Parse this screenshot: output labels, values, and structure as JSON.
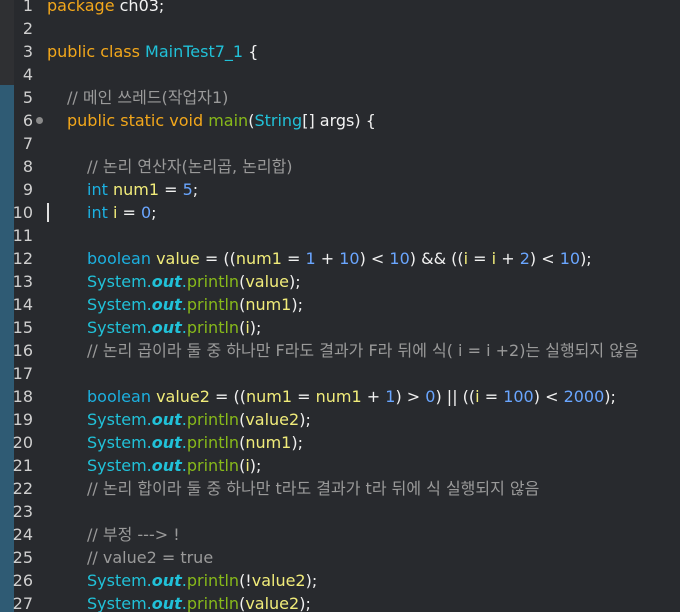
{
  "colors": {
    "background": "#282a2e",
    "keyword": "#f2a71b",
    "type": "#1cb0e0",
    "class_name": "#21c1d8",
    "method": "#87b91a",
    "variable": "#f1ec7a",
    "number": "#6aa6ff",
    "comment": "#9a9a9a",
    "change_bar": "#2f5b74"
  },
  "editor": {
    "cursor_line": 10,
    "lines": [
      {
        "n": "1",
        "indent": 0,
        "tokens": [
          {
            "t": "package",
            "c": "kw"
          },
          {
            "t": " ch03;",
            "c": "id"
          }
        ]
      },
      {
        "n": "2",
        "indent": 0,
        "tokens": []
      },
      {
        "n": "3",
        "indent": 0,
        "tokens": [
          {
            "t": "public",
            "c": "kw"
          },
          {
            "t": " ",
            "c": "id"
          },
          {
            "t": "class",
            "c": "kw"
          },
          {
            "t": " ",
            "c": "id"
          },
          {
            "t": "MainTest7_1",
            "c": "cl"
          },
          {
            "t": " {",
            "c": "id"
          }
        ]
      },
      {
        "n": "4",
        "indent": 0,
        "tokens": []
      },
      {
        "n": "5",
        "indent": 1,
        "tokens": [
          {
            "t": "// 메인 쓰레드(작업자1)",
            "c": "cm"
          }
        ]
      },
      {
        "n": "6",
        "indent": 1,
        "fold": true,
        "tokens": [
          {
            "t": "public",
            "c": "kw"
          },
          {
            "t": " ",
            "c": "id"
          },
          {
            "t": "static",
            "c": "kw"
          },
          {
            "t": " ",
            "c": "id"
          },
          {
            "t": "void",
            "c": "kw"
          },
          {
            "t": " ",
            "c": "id"
          },
          {
            "t": "main",
            "c": "fn"
          },
          {
            "t": "(",
            "c": "op"
          },
          {
            "t": "String",
            "c": "cl"
          },
          {
            "t": "[] ",
            "c": "op"
          },
          {
            "t": "args",
            "c": "id"
          },
          {
            "t": ") {",
            "c": "op"
          }
        ]
      },
      {
        "n": "7",
        "indent": 0,
        "tokens": []
      },
      {
        "n": "8",
        "indent": 2,
        "tokens": [
          {
            "t": "// 논리 연산자(논리곱, 논리합)",
            "c": "cm"
          }
        ]
      },
      {
        "n": "9",
        "indent": 2,
        "tokens": [
          {
            "t": "int",
            "c": "tp"
          },
          {
            "t": " ",
            "c": "id"
          },
          {
            "t": "num1",
            "c": "vr"
          },
          {
            "t": " = ",
            "c": "op"
          },
          {
            "t": "5",
            "c": "nm"
          },
          {
            "t": ";",
            "c": "op"
          }
        ]
      },
      {
        "n": "10",
        "indent": 2,
        "tokens": [
          {
            "t": "int",
            "c": "tp"
          },
          {
            "t": " ",
            "c": "id"
          },
          {
            "t": "i",
            "c": "vr"
          },
          {
            "t": " = ",
            "c": "op"
          },
          {
            "t": "0",
            "c": "nm"
          },
          {
            "t": ";",
            "c": "op"
          }
        ]
      },
      {
        "n": "11",
        "indent": 0,
        "tokens": []
      },
      {
        "n": "12",
        "indent": 2,
        "tokens": [
          {
            "t": "boolean",
            "c": "tp"
          },
          {
            "t": " ",
            "c": "id"
          },
          {
            "t": "value",
            "c": "vr"
          },
          {
            "t": " = ((",
            "c": "op"
          },
          {
            "t": "num1",
            "c": "vr"
          },
          {
            "t": " = ",
            "c": "op"
          },
          {
            "t": "1",
            "c": "nm"
          },
          {
            "t": " + ",
            "c": "op"
          },
          {
            "t": "10",
            "c": "nm"
          },
          {
            "t": ") < ",
            "c": "op"
          },
          {
            "t": "10",
            "c": "nm"
          },
          {
            "t": ") && ((",
            "c": "op"
          },
          {
            "t": "i",
            "c": "vr"
          },
          {
            "t": " = ",
            "c": "op"
          },
          {
            "t": "i",
            "c": "vr"
          },
          {
            "t": " + ",
            "c": "op"
          },
          {
            "t": "2",
            "c": "nm"
          },
          {
            "t": ") < ",
            "c": "op"
          },
          {
            "t": "10",
            "c": "nm"
          },
          {
            "t": ");",
            "c": "op"
          }
        ]
      },
      {
        "n": "13",
        "indent": 2,
        "tokens": [
          {
            "t": "System.",
            "c": "cl"
          },
          {
            "t": "out",
            "c": "fi"
          },
          {
            "t": ".",
            "c": "cl"
          },
          {
            "t": "println",
            "c": "fn"
          },
          {
            "t": "(",
            "c": "op"
          },
          {
            "t": "value",
            "c": "vr"
          },
          {
            "t": ");",
            "c": "op"
          }
        ]
      },
      {
        "n": "14",
        "indent": 2,
        "tokens": [
          {
            "t": "System.",
            "c": "cl"
          },
          {
            "t": "out",
            "c": "fi"
          },
          {
            "t": ".",
            "c": "cl"
          },
          {
            "t": "println",
            "c": "fn"
          },
          {
            "t": "(",
            "c": "op"
          },
          {
            "t": "num1",
            "c": "vr"
          },
          {
            "t": ");",
            "c": "op"
          }
        ]
      },
      {
        "n": "15",
        "indent": 2,
        "tokens": [
          {
            "t": "System.",
            "c": "cl"
          },
          {
            "t": "out",
            "c": "fi"
          },
          {
            "t": ".",
            "c": "cl"
          },
          {
            "t": "println",
            "c": "fn"
          },
          {
            "t": "(",
            "c": "op"
          },
          {
            "t": "i",
            "c": "vr"
          },
          {
            "t": ");",
            "c": "op"
          }
        ]
      },
      {
        "n": "16",
        "indent": 2,
        "tokens": [
          {
            "t": "// 논리 곱이라 둘 중 하나만 F라도 결과가 F라 뒤에 식( i = i +2)는 실행되지 않음",
            "c": "cm"
          }
        ]
      },
      {
        "n": "17",
        "indent": 0,
        "tokens": []
      },
      {
        "n": "18",
        "indent": 2,
        "tokens": [
          {
            "t": "boolean",
            "c": "tp"
          },
          {
            "t": " ",
            "c": "id"
          },
          {
            "t": "value2",
            "c": "vr"
          },
          {
            "t": " = ((",
            "c": "op"
          },
          {
            "t": "num1",
            "c": "vr"
          },
          {
            "t": " = ",
            "c": "op"
          },
          {
            "t": "num1",
            "c": "vr"
          },
          {
            "t": " + ",
            "c": "op"
          },
          {
            "t": "1",
            "c": "nm"
          },
          {
            "t": ") > ",
            "c": "op"
          },
          {
            "t": "0",
            "c": "nm"
          },
          {
            "t": ") || ((",
            "c": "op"
          },
          {
            "t": "i",
            "c": "vr"
          },
          {
            "t": " = ",
            "c": "op"
          },
          {
            "t": "100",
            "c": "nm"
          },
          {
            "t": ") < ",
            "c": "op"
          },
          {
            "t": "2000",
            "c": "nm"
          },
          {
            "t": ");",
            "c": "op"
          }
        ]
      },
      {
        "n": "19",
        "indent": 2,
        "tokens": [
          {
            "t": "System.",
            "c": "cl"
          },
          {
            "t": "out",
            "c": "fi"
          },
          {
            "t": ".",
            "c": "cl"
          },
          {
            "t": "println",
            "c": "fn"
          },
          {
            "t": "(",
            "c": "op"
          },
          {
            "t": "value2",
            "c": "vr"
          },
          {
            "t": ");",
            "c": "op"
          }
        ]
      },
      {
        "n": "20",
        "indent": 2,
        "tokens": [
          {
            "t": "System.",
            "c": "cl"
          },
          {
            "t": "out",
            "c": "fi"
          },
          {
            "t": ".",
            "c": "cl"
          },
          {
            "t": "println",
            "c": "fn"
          },
          {
            "t": "(",
            "c": "op"
          },
          {
            "t": "num1",
            "c": "vr"
          },
          {
            "t": ");",
            "c": "op"
          }
        ]
      },
      {
        "n": "21",
        "indent": 2,
        "tokens": [
          {
            "t": "System.",
            "c": "cl"
          },
          {
            "t": "out",
            "c": "fi"
          },
          {
            "t": ".",
            "c": "cl"
          },
          {
            "t": "println",
            "c": "fn"
          },
          {
            "t": "(",
            "c": "op"
          },
          {
            "t": "i",
            "c": "vr"
          },
          {
            "t": ");",
            "c": "op"
          }
        ]
      },
      {
        "n": "22",
        "indent": 2,
        "tokens": [
          {
            "t": "// 논리 합이라 둘 중 하나만 t라도 결과가 t라 뒤에 식 실행되지 않음",
            "c": "cm"
          }
        ]
      },
      {
        "n": "23",
        "indent": 0,
        "tokens": []
      },
      {
        "n": "24",
        "indent": 2,
        "tokens": [
          {
            "t": "// 부정 ---> !",
            "c": "cm"
          }
        ]
      },
      {
        "n": "25",
        "indent": 2,
        "tokens": [
          {
            "t": "// value2 = true",
            "c": "cm"
          }
        ]
      },
      {
        "n": "26",
        "indent": 2,
        "tokens": [
          {
            "t": "System.",
            "c": "cl"
          },
          {
            "t": "out",
            "c": "fi"
          },
          {
            "t": ".",
            "c": "cl"
          },
          {
            "t": "println",
            "c": "fn"
          },
          {
            "t": "(!",
            "c": "op"
          },
          {
            "t": "value2",
            "c": "vr"
          },
          {
            "t": ");",
            "c": "op"
          }
        ]
      },
      {
        "n": "27",
        "indent": 2,
        "tokens": [
          {
            "t": "System.",
            "c": "cl"
          },
          {
            "t": "out",
            "c": "fi"
          },
          {
            "t": ".",
            "c": "cl"
          },
          {
            "t": "println",
            "c": "fn"
          },
          {
            "t": "(",
            "c": "op"
          },
          {
            "t": "value2",
            "c": "vr"
          },
          {
            "t": ");",
            "c": "op"
          }
        ]
      }
    ]
  }
}
